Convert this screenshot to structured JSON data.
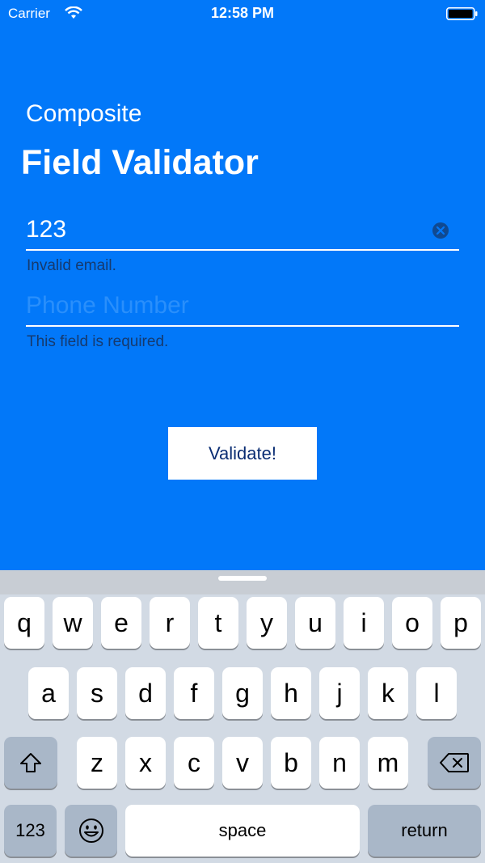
{
  "status": {
    "carrier": "Carrier",
    "time": "12:58 PM"
  },
  "header": {
    "subtitle": "Composite",
    "title": "Field Validator"
  },
  "form": {
    "email": {
      "value": "123",
      "placeholder": "",
      "error": "Invalid email."
    },
    "phone": {
      "value": "",
      "placeholder": "Phone Number",
      "error": "This field is required."
    },
    "validate_label": "Validate!"
  },
  "keyboard": {
    "row1": [
      "q",
      "w",
      "e",
      "r",
      "t",
      "y",
      "u",
      "i",
      "o",
      "p"
    ],
    "row2": [
      "a",
      "s",
      "d",
      "f",
      "g",
      "h",
      "j",
      "k",
      "l"
    ],
    "row3": [
      "z",
      "x",
      "c",
      "v",
      "b",
      "n",
      "m"
    ],
    "numbers_label": "123",
    "space_label": "space",
    "return_label": "return"
  },
  "colors": {
    "background": "#0278f9",
    "error_text": "#163a6e",
    "button_text": "#0a2d73"
  }
}
